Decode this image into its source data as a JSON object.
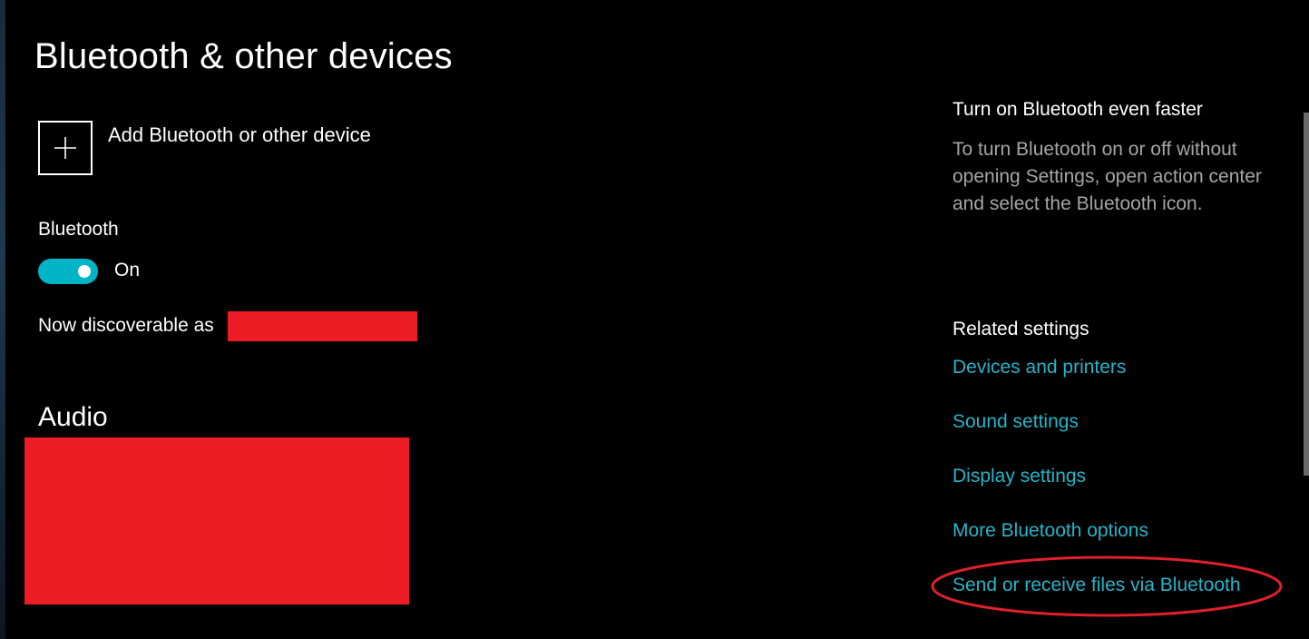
{
  "page": {
    "title": "Bluetooth & other devices"
  },
  "add_device": {
    "label": "Add Bluetooth or other device",
    "icon": "plus-icon"
  },
  "bluetooth": {
    "label": "Bluetooth",
    "state_label": "On",
    "is_on": true,
    "discoverable_prefix": "Now discoverable as"
  },
  "audio": {
    "heading": "Audio"
  },
  "tip": {
    "title": "Turn on Bluetooth even faster",
    "body": "To turn Bluetooth on or off without opening Settings, open action center and select the Bluetooth icon."
  },
  "related": {
    "heading": "Related settings",
    "links": [
      "Devices and printers",
      "Sound settings",
      "Display settings",
      "More Bluetooth options",
      "Send or receive files via Bluetooth"
    ]
  },
  "colors": {
    "background": "#000000",
    "accent": "#00b4c8",
    "link": "#27b4c8",
    "redaction": "#ee1c25",
    "annotation": "#e0202a"
  }
}
